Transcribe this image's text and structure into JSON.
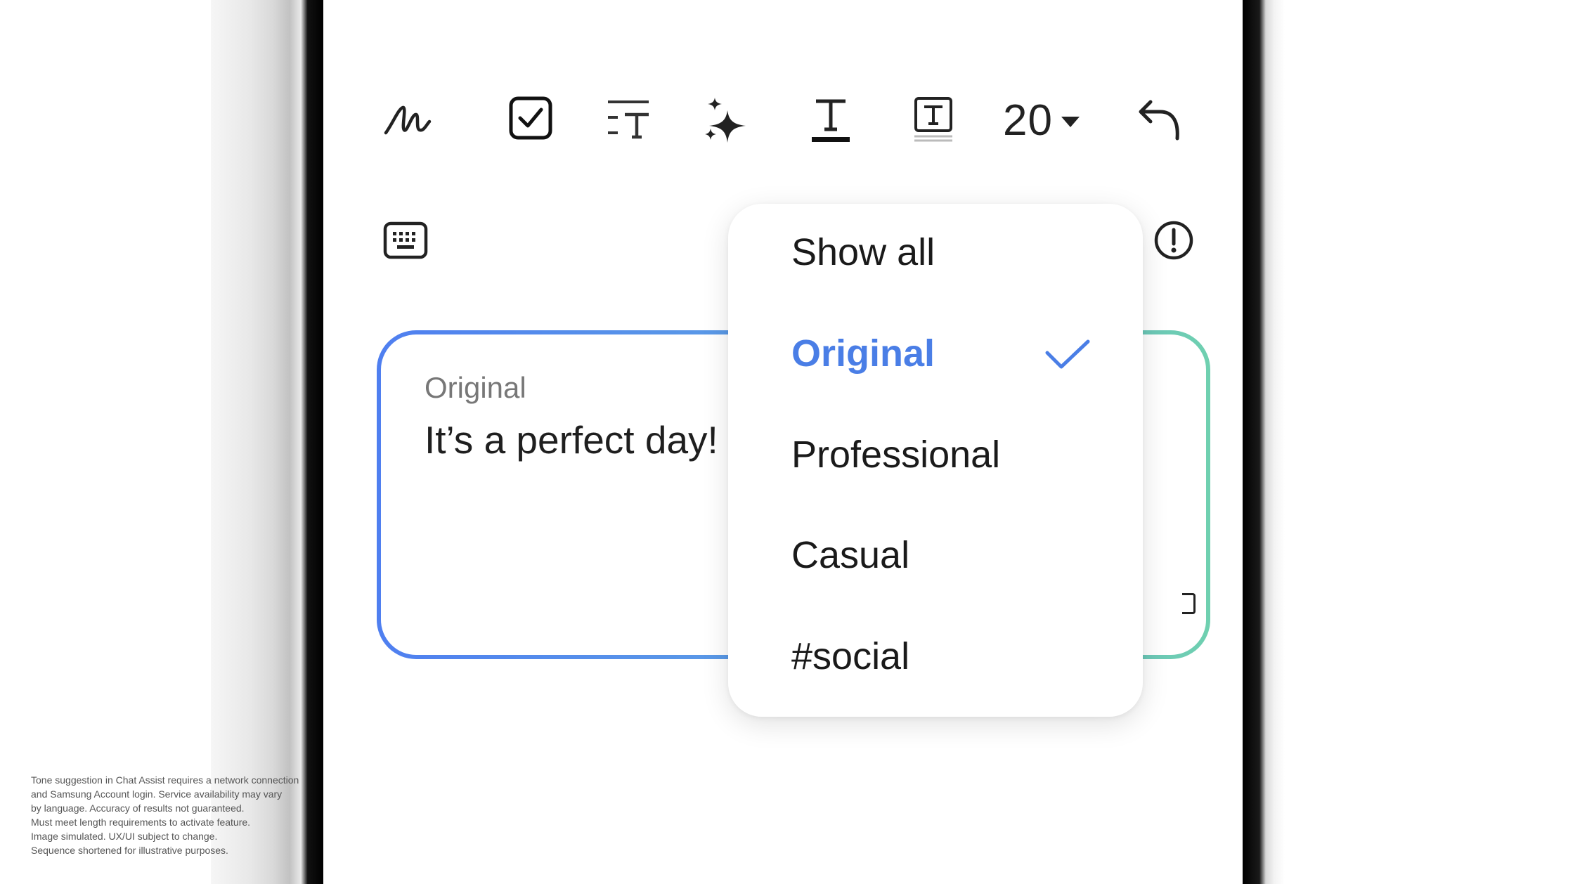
{
  "toolbar": {
    "icons": [
      "handwriting-icon",
      "checkbox-icon",
      "text-style-icon",
      "sparkle-ai-icon",
      "text-underline-icon",
      "text-box-icon",
      "undo-icon"
    ],
    "font_size": "20"
  },
  "secondary_bar": {
    "icons": [
      "keyboard-icon",
      "info-alert-icon"
    ]
  },
  "card": {
    "label": "Original",
    "text": "It’s a perfect day!"
  },
  "dropdown": {
    "items": [
      {
        "label": "Show all",
        "selected": false
      },
      {
        "label": "Original",
        "selected": true
      },
      {
        "label": "Professional",
        "selected": false
      },
      {
        "label": "Casual",
        "selected": false
      },
      {
        "label": "#social",
        "selected": false
      }
    ]
  },
  "colors": {
    "accent": "#4a7ee6",
    "gradient_start": "#4f7ff0",
    "gradient_end": "#6fd0b0"
  },
  "disclaimer": {
    "lines": [
      "Tone suggestion in Chat Assist requires a network connection",
      "and Samsung Account login. Service availability may vary",
      "by language. Accuracy of results not guaranteed.",
      "Must meet length requirements to activate feature.",
      "Image simulated. UX/UI subject to change.",
      "Sequence shortened for illustrative purposes."
    ]
  }
}
